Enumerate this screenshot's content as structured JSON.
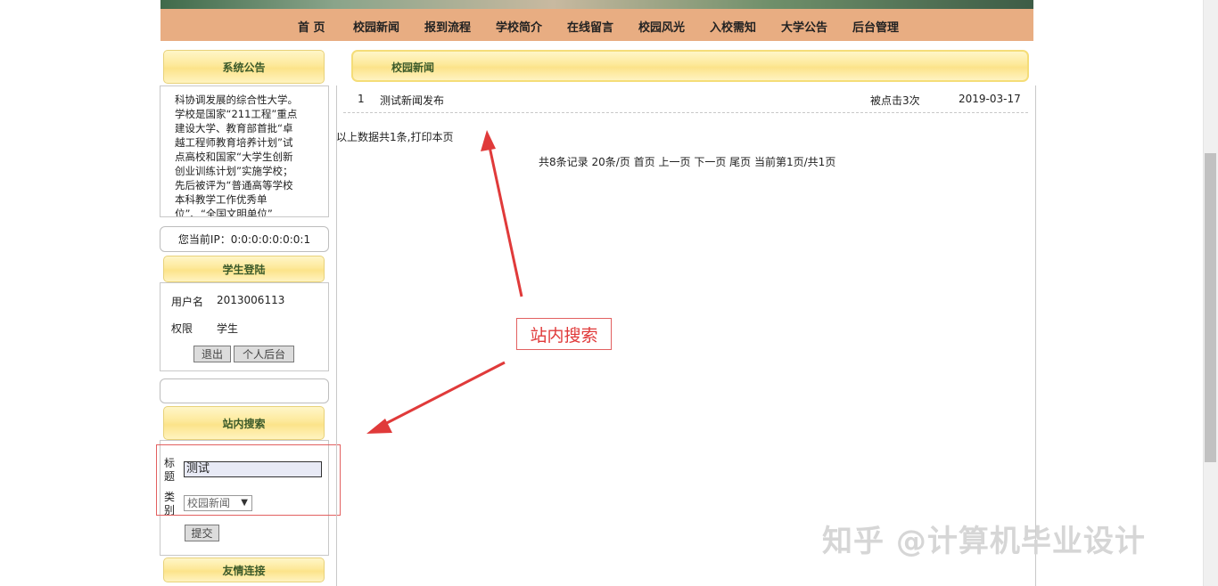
{
  "nav": {
    "items": [
      "首 页",
      "校园新闻",
      "报到流程",
      "学校简介",
      "在线留言",
      "校园风光",
      "入校需知",
      "大学公告",
      "后台管理"
    ]
  },
  "notice": {
    "title": "系统公告",
    "lines": [
      "科协调发展的综合性大学。",
      "学校是国家“211工程”重点",
      "建设大学、教育部首批“卓",
      "越工程师教育培养计划”试",
      "点高校和国家“大学生创新",
      "创业训练计划”实施学校；",
      "先后被评为“普通高等学校",
      "本科教学工作优秀单",
      "位”、“全国文明单位”"
    ]
  },
  "ip": {
    "text": "您当前IP：0:0:0:0:0:0:0:1"
  },
  "login": {
    "title": "学生登陆",
    "username_label": "用户名",
    "username_value": "2013006113",
    "role_label": "权限",
    "role_value": "学生",
    "logout_label": "退出",
    "personal_label": "个人后台"
  },
  "search": {
    "title": "站内搜索",
    "title_label": "标题",
    "title_value": "测试",
    "category_label": "类别",
    "category_value": "校园新闻",
    "submit_label": "提交"
  },
  "links": {
    "title": "友情连接"
  },
  "main": {
    "header": "校园新闻",
    "news": [
      {
        "index": "1",
        "title": "测试新闻发布",
        "clicks": "被点击3次",
        "date": "2019-03-17"
      }
    ],
    "summary": "以上数据共1条,打印本页",
    "pagination": {
      "total": "共8条记录",
      "per_page": "20条/页",
      "first": "首页",
      "prev": "上一页",
      "next": "下一页",
      "last": "尾页",
      "current": "当前第1页/共1页"
    }
  },
  "annotation": {
    "label": "站内搜索",
    "color": "#e03a3a"
  },
  "watermark": {
    "text": "知乎 @计算机毕业设计"
  },
  "colors": {
    "nav_bg": "#e8ad82",
    "header_yellow": "#fce38a"
  }
}
